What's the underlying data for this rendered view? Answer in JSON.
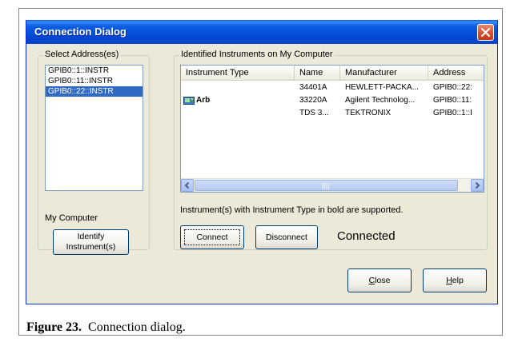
{
  "window": {
    "title": "Connection Dialog"
  },
  "address_group": {
    "legend": "Select Address(es)",
    "items": [
      {
        "label": "GPIB0::1::INSTR",
        "selected": false
      },
      {
        "label": "GPIB0::11::INSTR",
        "selected": false
      },
      {
        "label": "GPIB0::22::INSTR",
        "selected": true
      }
    ],
    "computer_label": "My Computer",
    "identify_button": "Identify Instrument(s)"
  },
  "instruments_group": {
    "legend": "Identified Instruments on My Computer",
    "columns": [
      "Instrument Type",
      "Name",
      "Manufacturer",
      "Address"
    ],
    "rows": [
      {
        "type": "",
        "name": "34401A",
        "manufacturer": "HEWLETT-PACKA...",
        "address": "GPIB0::22:",
        "bold": false,
        "icon": ""
      },
      {
        "type": "Arb",
        "name": "33220A",
        "manufacturer": "Agilent Technolog...",
        "address": "GPIB0::11:",
        "bold": true,
        "icon": "instrument-icon"
      },
      {
        "type": "",
        "name": "TDS 3...",
        "manufacturer": "TEKTRONIX",
        "address": "GPIB0::1::I",
        "bold": false,
        "icon": ""
      }
    ],
    "note": "Instrument(s) with Instrument Type in bold are supported.",
    "connect_button": "Connect",
    "disconnect_button": "Disconnect",
    "status": "Connected"
  },
  "footer": {
    "close_button": "Close",
    "help_button": "Help"
  },
  "caption": {
    "figure_number": "Figure 23.",
    "text": "Connection dialog."
  },
  "colors": {
    "titlebar": "#0a5fe4",
    "selection": "#316ac5",
    "dialog_bg": "#ece9d8"
  }
}
